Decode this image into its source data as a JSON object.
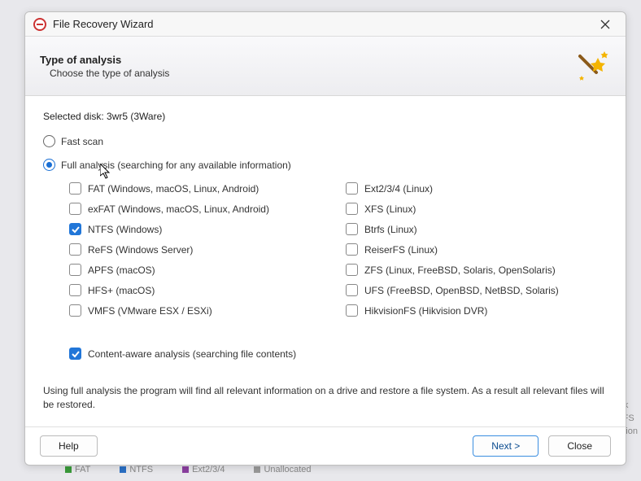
{
  "window": {
    "title": "File Recovery Wizard"
  },
  "header": {
    "title": "Type of analysis",
    "subtitle": "Choose the type of analysis"
  },
  "selected_disk_label": "Selected disk: 3wr5 (3Ware)",
  "radios": {
    "fast": {
      "label": "Fast scan",
      "selected": false
    },
    "full": {
      "label": "Full analysis (searching for any available information)",
      "selected": true
    }
  },
  "filesystems_left": [
    {
      "label": "FAT (Windows, macOS, Linux, Android)",
      "checked": false
    },
    {
      "label": "exFAT (Windows, macOS, Linux, Android)",
      "checked": false
    },
    {
      "label": "NTFS (Windows)",
      "checked": true
    },
    {
      "label": "ReFS (Windows Server)",
      "checked": false
    },
    {
      "label": "APFS (macOS)",
      "checked": false
    },
    {
      "label": "HFS+ (macOS)",
      "checked": false
    },
    {
      "label": "VMFS (VMware ESX / ESXi)",
      "checked": false
    }
  ],
  "filesystems_right": [
    {
      "label": "Ext2/3/4 (Linux)",
      "checked": false
    },
    {
      "label": "XFS (Linux)",
      "checked": false
    },
    {
      "label": "Btrfs (Linux)",
      "checked": false
    },
    {
      "label": "ReiserFS (Linux)",
      "checked": false
    },
    {
      "label": "ZFS (Linux, FreeBSD, Solaris, OpenSolaris)",
      "checked": false
    },
    {
      "label": "UFS (FreeBSD, OpenBSD, NetBSD, Solaris)",
      "checked": false
    },
    {
      "label": "HikvisionFS (Hikvision DVR)",
      "checked": false
    }
  ],
  "content_aware": {
    "label": "Content-aware analysis (searching file contents)",
    "checked": true
  },
  "description": "Using full analysis the program will find all relevant information on a drive and restore a file system. As a result all relevant files will be restored.",
  "buttons": {
    "help": "Help",
    "next": "Next >",
    "close": "Close"
  },
  "bg_legend": [
    "FAT",
    "NTFS",
    "Ext2/3/4",
    "Unallocated"
  ],
  "bg_side": [
    "Disk",
    "NTFS",
    "artition"
  ]
}
